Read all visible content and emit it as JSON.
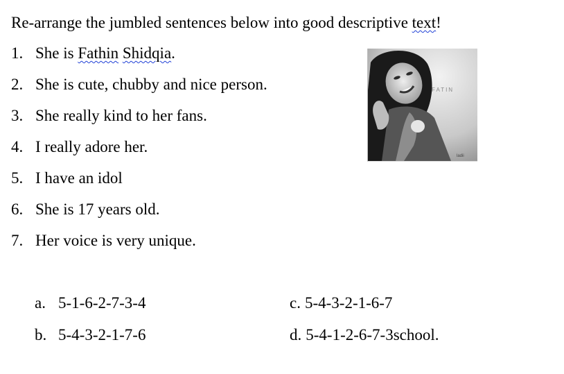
{
  "title": {
    "main": "Re-arrange the jumbled sentences below into good descriptive ",
    "squiggled": "text",
    "end": "!"
  },
  "sentences": [
    {
      "num": "1.",
      "parts": [
        "She is ",
        "Fathin",
        " ",
        "Shidqia",
        "."
      ]
    },
    {
      "num": "2.",
      "text": "She is cute, chubby and nice person."
    },
    {
      "num": "3.",
      "text": "She really kind to her fans."
    },
    {
      "num": "4.",
      "text": "I really adore her."
    },
    {
      "num": "5.",
      "text": "I have an idol"
    },
    {
      "num": "6.",
      "text": "She is 17 years old."
    },
    {
      "num": "7.",
      "text": "Her voice is very unique."
    }
  ],
  "photo": {
    "watermark": "FATIN",
    "corner_mark": "ladii"
  },
  "options": [
    {
      "label": "a.",
      "value": "5-1-6-2-7-3-4"
    },
    {
      "label": "b.",
      "value": "5-4-3-2-1-7-6"
    },
    {
      "label": "c.",
      "value": "5-4-3-2-1-6-7"
    },
    {
      "label": "d.",
      "value": "5-4-1-2-6-7-3school."
    }
  ]
}
